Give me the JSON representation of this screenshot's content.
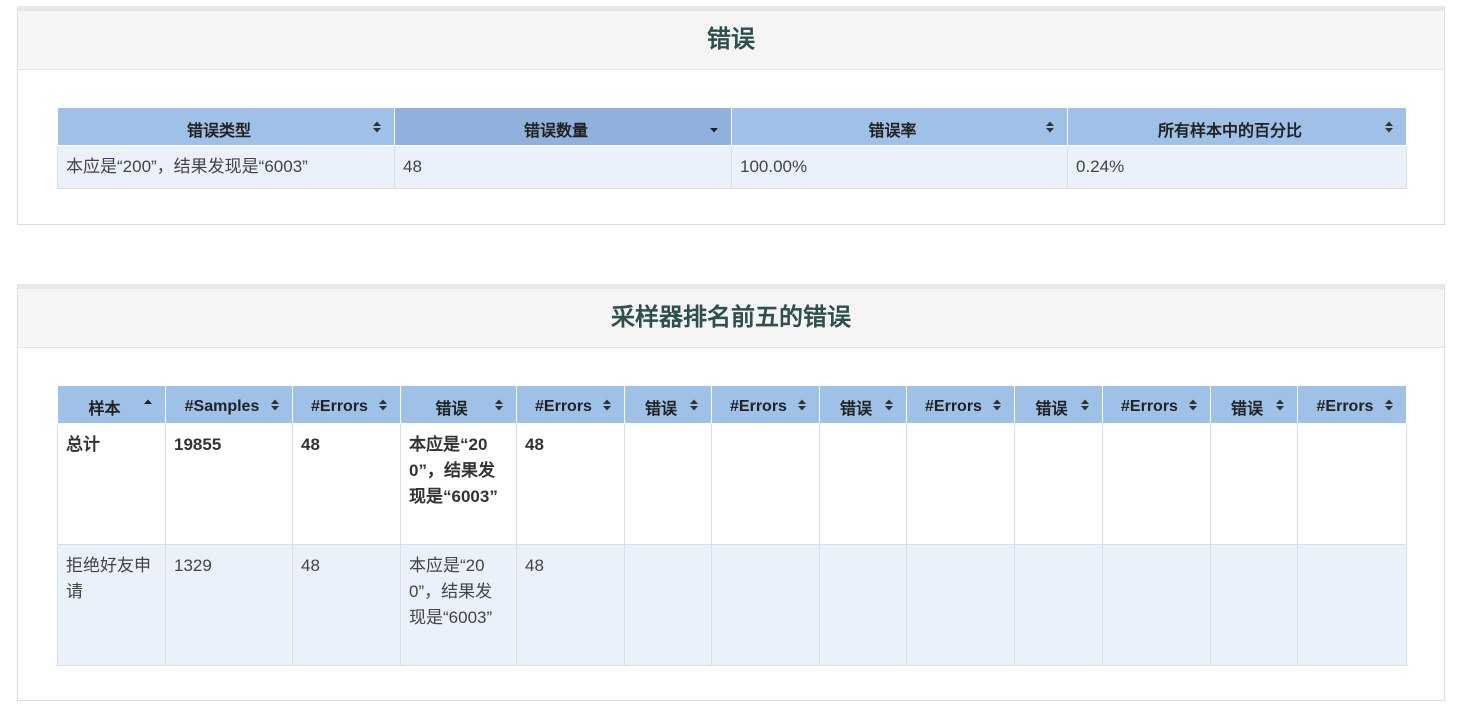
{
  "errors_panel": {
    "title": "错误",
    "columns": [
      {
        "label": "错误类型",
        "sort": "none"
      },
      {
        "label": "错误数量",
        "sort": "desc"
      },
      {
        "label": "错误率",
        "sort": "none"
      },
      {
        "label": "所有样本中的百分比",
        "sort": "none"
      }
    ],
    "rows": [
      [
        "本应是“200”，结果发现是“6003”",
        "48",
        "100.00%",
        "0.24%"
      ]
    ]
  },
  "top5_panel": {
    "title": "采样器排名前五的错误",
    "columns": [
      {
        "label": "样本",
        "sort": "asc"
      },
      {
        "label": "#Samples",
        "sort": "none"
      },
      {
        "label": "#Errors",
        "sort": "none"
      },
      {
        "label": "错误",
        "sort": "none"
      },
      {
        "label": "#Errors",
        "sort": "none"
      },
      {
        "label": "错误",
        "sort": "none"
      },
      {
        "label": "#Errors",
        "sort": "none"
      },
      {
        "label": "错误",
        "sort": "none"
      },
      {
        "label": "#Errors",
        "sort": "none"
      },
      {
        "label": "错误",
        "sort": "none"
      },
      {
        "label": "#Errors",
        "sort": "none"
      },
      {
        "label": "错误",
        "sort": "none"
      },
      {
        "label": "#Errors",
        "sort": "none"
      }
    ],
    "total_row": [
      "总计",
      "19855",
      "48",
      "本应是“200”，结果发现是“6003”",
      "48",
      "",
      "",
      "",
      "",
      "",
      "",
      "",
      ""
    ],
    "rows": [
      [
        "拒绝好友申请",
        "1329",
        "48",
        "本应是“200”，结果发现是“6003”",
        "48",
        "",
        "",
        "",
        "",
        "",
        "",
        "",
        ""
      ]
    ]
  },
  "colors": {
    "header_bg": "#9fc0e7",
    "header_active_bg": "#8fb1dc",
    "row_alt_bg": "#eaf1fa",
    "title_color": "#2f4f4f"
  },
  "icons": {
    "sort_none": "sort-both-icon",
    "sort_asc": "sort-up-icon",
    "sort_desc": "sort-down-icon"
  }
}
